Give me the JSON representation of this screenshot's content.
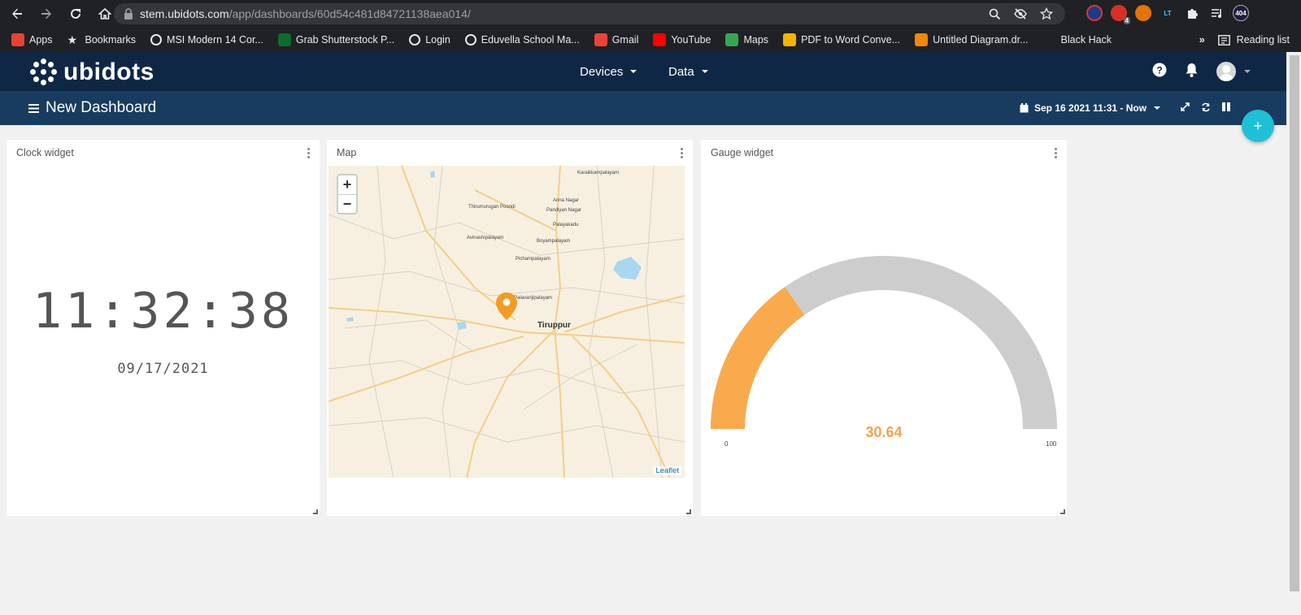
{
  "browser": {
    "url_host": "stem.ubidots.com",
    "url_path": "/app/dashboards/60d54c481d84721138aea014/",
    "bookmarks": [
      {
        "label": "Apps",
        "icon": "apps-grid-icon",
        "color": "#e94235"
      },
      {
        "label": "Bookmarks",
        "icon": "star-icon",
        "color": "#e8eaed"
      },
      {
        "label": "MSI Modern 14 Cor...",
        "icon": "globe-icon",
        "color": "#e8eaed"
      },
      {
        "label": "Grab Shutterstock P...",
        "icon": "shutterstock-icon",
        "color": "#0d6b2e"
      },
      {
        "label": "Login",
        "icon": "globe-icon",
        "color": "#e8eaed"
      },
      {
        "label": "Eduvella School Ma...",
        "icon": "globe-icon",
        "color": "#e8eaed"
      },
      {
        "label": "Gmail",
        "icon": "gmail-icon",
        "color": "#ea4335"
      },
      {
        "label": "YouTube",
        "icon": "youtube-icon",
        "color": "#ff0000"
      },
      {
        "label": "Maps",
        "icon": "maps-icon",
        "color": "#34a853"
      },
      {
        "label": "PDF to Word Conve...",
        "icon": "pdf-icon",
        "color": "#f4b400"
      },
      {
        "label": "Untitled Diagram.dr...",
        "icon": "drawio-icon",
        "color": "#f08705"
      },
      {
        "label": "Black Hack",
        "icon": "blank-icon",
        "color": "#202124"
      }
    ],
    "reading_list": "Reading list",
    "extension_badge": "4",
    "profile_badge": "404"
  },
  "header": {
    "logo_text": "ubidots",
    "menu": [
      {
        "label": "Devices"
      },
      {
        "label": "Data"
      }
    ]
  },
  "dashboard": {
    "title": "New Dashboard",
    "date_range": "Sep 16 2021 11:31 - Now",
    "fab_label": "+"
  },
  "widgets": {
    "clock": {
      "title": "Clock widget",
      "time": "11:32:38",
      "date": "09/17/2021"
    },
    "map": {
      "title": "Map",
      "zoom_in": "+",
      "zoom_out": "−",
      "attribution": "Leaflet",
      "city_label": "Tiruppur",
      "place_labels": [
        "Karaikkampalayam",
        "Thirumurugan Poondi",
        "Anna Nagar",
        "Pandiyan Nagar",
        "Avinashipalayam",
        "Palayakadu",
        "Boyampalayam",
        "Pichampalayam",
        "Palavanjipalayam"
      ]
    },
    "gauge": {
      "title": "Gauge widget",
      "value": 30.64,
      "value_label": "30.64",
      "min": "0",
      "max": "100",
      "fill_color": "#f8aa4d",
      "track_color": "#cdcdcd"
    }
  }
}
